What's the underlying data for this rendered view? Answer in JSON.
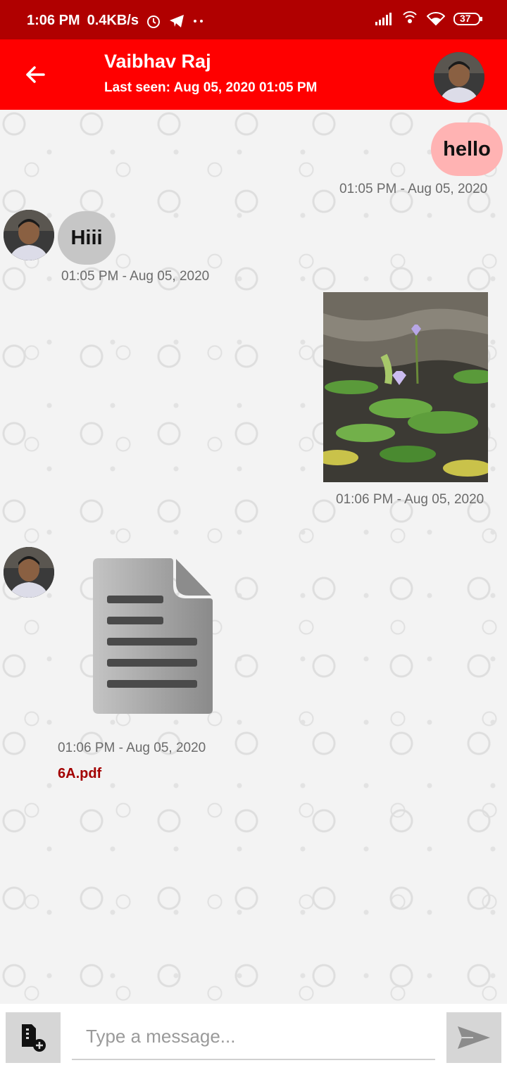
{
  "status_bar": {
    "time": "1:06 PM",
    "speed": "0.4KB/s",
    "battery": "37",
    "icons": [
      "alarm-icon",
      "telegram-icon",
      "more-dots-icon",
      "signal-icon",
      "hotspot-icon",
      "wifi-icon",
      "battery-icon"
    ]
  },
  "header": {
    "name": "Vaibhav Raj",
    "last_seen": "Last seen: Aug 05, 2020 01:05 PM",
    "accent_color": "#ff0000",
    "status_bar_color": "#b00000"
  },
  "messages": [
    {
      "direction": "outgoing",
      "type": "text",
      "text": "hello",
      "time": "01:05 PM - Aug 05, 2020"
    },
    {
      "direction": "incoming",
      "type": "text",
      "text": "Hiii",
      "time": "01:05 PM - Aug 05, 2020"
    },
    {
      "direction": "outgoing",
      "type": "image",
      "time": "01:06 PM - Aug 05, 2020"
    },
    {
      "direction": "incoming",
      "type": "file",
      "file_name": "6A.pdf",
      "time": "01:06 PM - Aug 05, 2020"
    }
  ],
  "composer": {
    "placeholder": "Type a message...",
    "value": ""
  }
}
